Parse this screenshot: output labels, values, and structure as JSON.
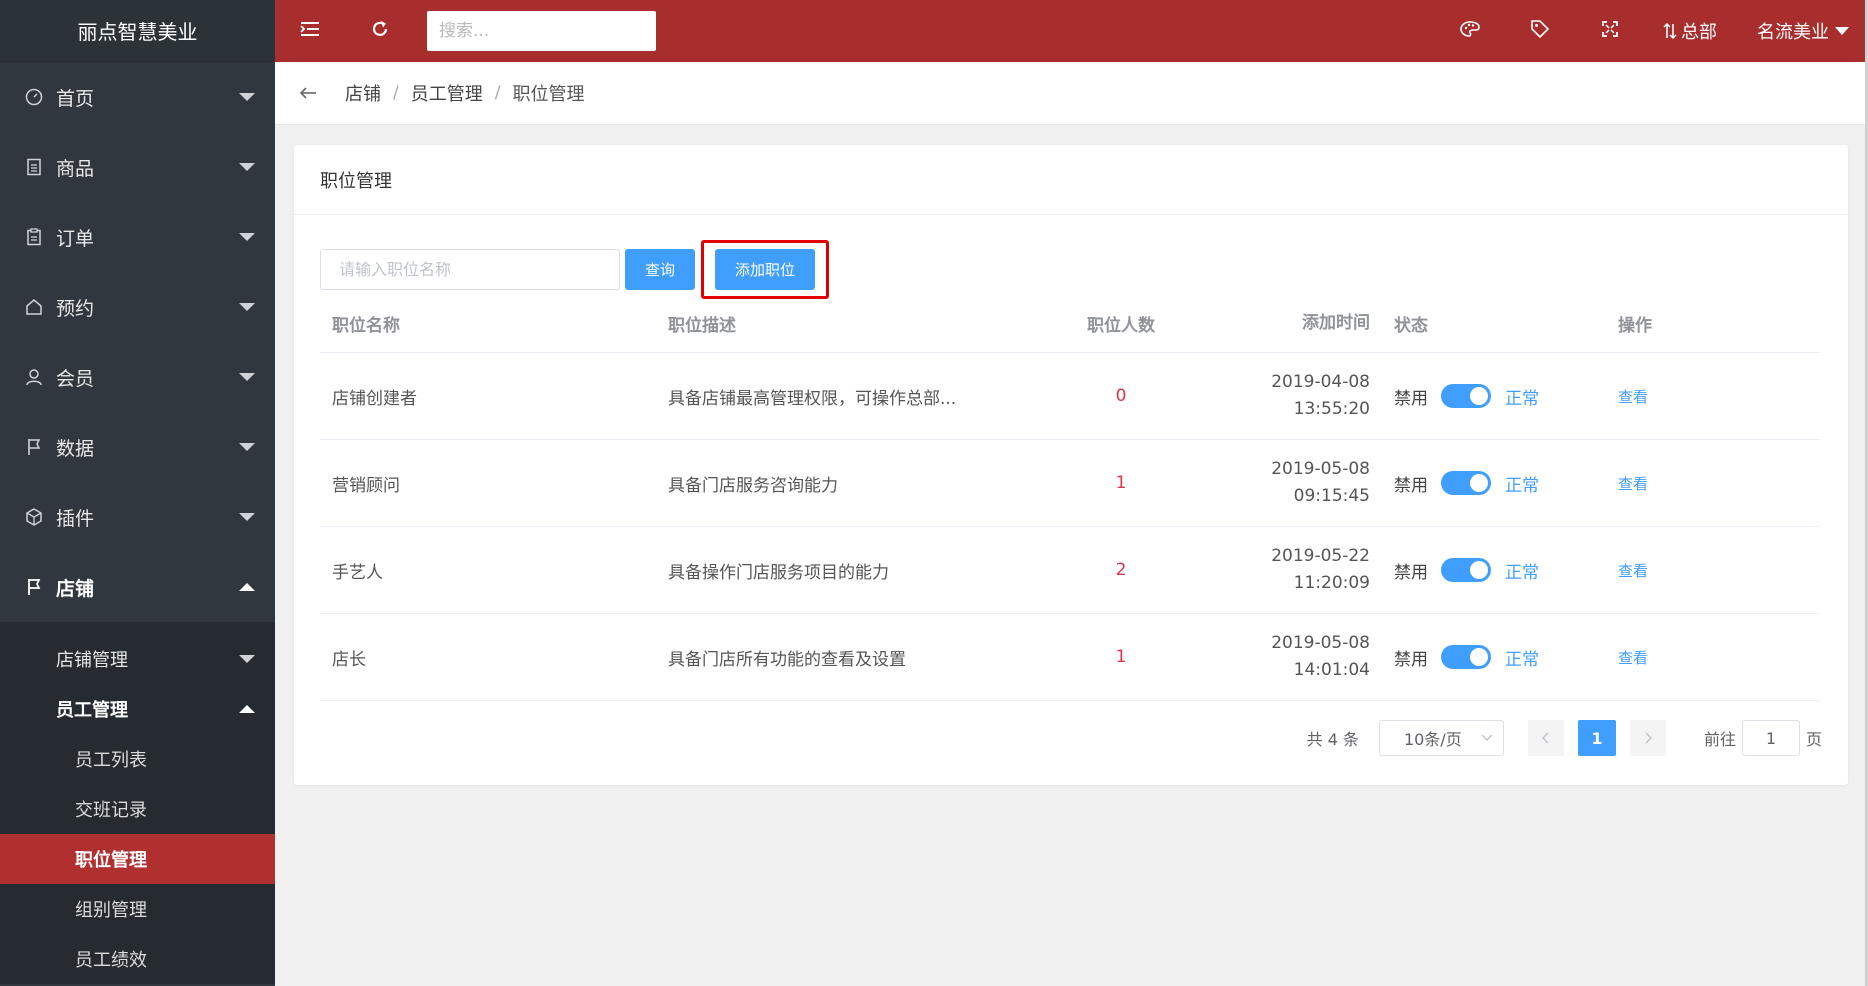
{
  "sidebar": {
    "brand": "丽点智慧美业",
    "items": [
      {
        "label": "首页",
        "icon": "dashboard-icon"
      },
      {
        "label": "商品",
        "icon": "document-icon"
      },
      {
        "label": "订单",
        "icon": "clipboard-icon"
      },
      {
        "label": "预约",
        "icon": "home-icon"
      },
      {
        "label": "会员",
        "icon": "user-icon"
      },
      {
        "label": "数据",
        "icon": "flag-icon"
      },
      {
        "label": "插件",
        "icon": "cube-icon"
      },
      {
        "label": "店铺",
        "icon": "flag-icon"
      }
    ],
    "sub": {
      "store_manage": "店铺管理",
      "staff_manage": "员工管理",
      "leaves": [
        "员工列表",
        "交班记录",
        "职位管理",
        "组别管理",
        "员工绩效"
      ]
    }
  },
  "topbar": {
    "search_placeholder": "搜索...",
    "branch": "总部",
    "user": "名流美业"
  },
  "breadcrumb": [
    "店铺",
    "员工管理",
    "职位管理"
  ],
  "card": {
    "title": "职位管理",
    "query_placeholder": "请输入职位名称",
    "query_btn": "查询",
    "add_btn": "添加职位"
  },
  "table": {
    "headers": [
      "职位名称",
      "职位描述",
      "职位人数",
      "添加时间",
      "状态",
      "操作"
    ],
    "rows": [
      {
        "name": "店铺创建者",
        "desc": "具备店铺最高管理权限，可操作总部...",
        "count": "0",
        "date": "2019-04-08",
        "time": "13:55:20",
        "off": "禁用",
        "on": "正常",
        "action": "查看"
      },
      {
        "name": "营销顾问",
        "desc": "具备门店服务咨询能力",
        "count": "1",
        "date": "2019-05-08",
        "time": "09:15:45",
        "off": "禁用",
        "on": "正常",
        "action": "查看"
      },
      {
        "name": "手艺人",
        "desc": "具备操作门店服务项目的能力",
        "count": "2",
        "date": "2019-05-22",
        "time": "11:20:09",
        "off": "禁用",
        "on": "正常",
        "action": "查看"
      },
      {
        "name": "店长",
        "desc": "具备门店所有功能的查看及设置",
        "count": "1",
        "date": "2019-05-08",
        "time": "14:01:04",
        "off": "禁用",
        "on": "正常",
        "action": "查看"
      }
    ]
  },
  "pagination": {
    "total": "共 4 条",
    "page_size": "10条/页",
    "current": "1",
    "goto_label": "前往",
    "goto_value": "1",
    "page_suffix": "页"
  },
  "colors": {
    "topbar": "#a82e2e",
    "sidebar": "#30373f",
    "selected": "#b0302f",
    "primary": "#409eff",
    "count": "#e0344b",
    "highlight": "#e00000"
  }
}
